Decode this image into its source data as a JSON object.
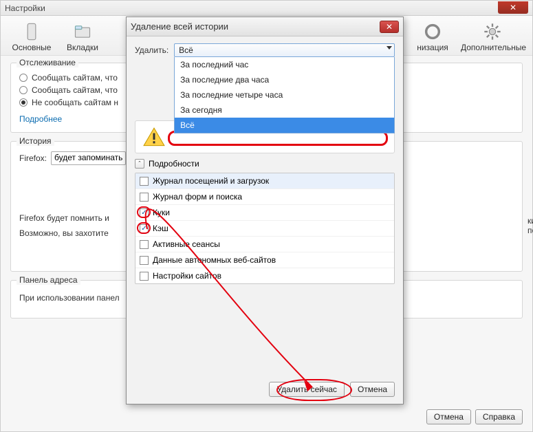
{
  "settings_window": {
    "title": "Настройки",
    "toolbar": {
      "items": [
        {
          "label": "Основные"
        },
        {
          "label": "Вкладки"
        },
        {
          "label": ""
        },
        {
          "label": "низация"
        },
        {
          "label": "Дополнительные"
        }
      ]
    },
    "tracking": {
      "legend": "Отслеживание",
      "opt_allow": "Сообщать сайтам, что",
      "opt_allow2": "Сообщать сайтам, что",
      "opt_deny": "Не сообщать сайтам н",
      "more": "Подробнее"
    },
    "history": {
      "legend": "История",
      "label": "Firefox:",
      "mode": "будет запоминать",
      "para1": "Firefox будет помнить и",
      "para1_tail": "ки, оставленные посещёнными вами ве",
      "para2": "Возможно, вы захотите"
    },
    "address": {
      "legend": "Панель адреса",
      "label": "При использовании панел"
    },
    "buttons": {
      "cancel": "Отмена",
      "help": "Справка"
    }
  },
  "dialog": {
    "title": "Удаление всей истории",
    "delete_label": "Удалить:",
    "combo": {
      "selected": "Всё",
      "options": [
        "За последний час",
        "За последние два часа",
        "За последние четыре часа",
        "За сегодня",
        "Всё"
      ]
    },
    "details_label": "Подробности",
    "disc_glyph": "ˆ",
    "checklist": [
      {
        "label": "Журнал посещений и загрузок",
        "checked": false,
        "hl": true
      },
      {
        "label": "Журнал форм и поиска",
        "checked": false
      },
      {
        "label": "Куки",
        "checked": true,
        "ann": true
      },
      {
        "label": "Кэш",
        "checked": true,
        "ann": true
      },
      {
        "label": "Активные сеансы",
        "checked": false
      },
      {
        "label": "Данные автономных веб-сайтов",
        "checked": false
      },
      {
        "label": "Настройки сайтов",
        "checked": false
      }
    ],
    "buttons": {
      "delete_now": "Удалить сейчас",
      "cancel": "Отмена"
    }
  },
  "icons": {
    "check": "✓",
    "close_x": "✕"
  }
}
